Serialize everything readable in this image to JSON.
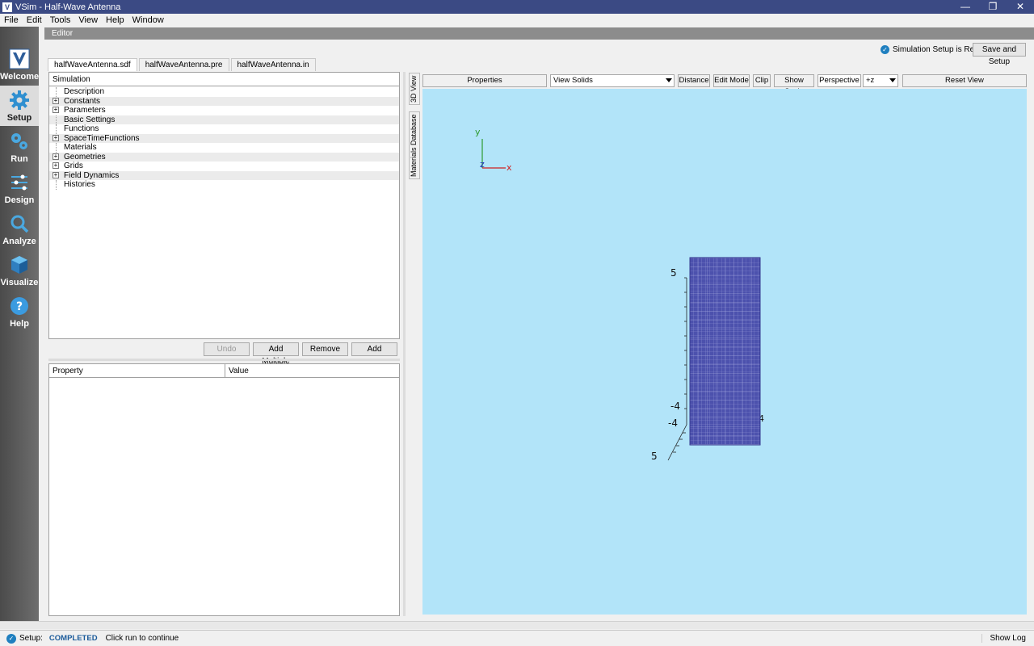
{
  "window": {
    "title": "VSim - Half-Wave Antenna",
    "app_icon": "V",
    "controls": [
      "—",
      "❐",
      "✕"
    ]
  },
  "menu": [
    "File",
    "Edit",
    "Tools",
    "View",
    "Help",
    "Window"
  ],
  "nav": [
    {
      "label": "Welcome",
      "icon": "vsim-logo-icon"
    },
    {
      "label": "Setup",
      "icon": "gear-icon"
    },
    {
      "label": "Run",
      "icon": "gears-icon"
    },
    {
      "label": "Design",
      "icon": "sliders-icon"
    },
    {
      "label": "Analyze",
      "icon": "magnifier-icon"
    },
    {
      "label": "Visualize",
      "icon": "cube-icon"
    },
    {
      "label": "Help",
      "icon": "question-icon"
    }
  ],
  "editor": {
    "header": "Editor",
    "setup_status": "Simulation Setup is Ready",
    "save_setup_label": "Save and Setup",
    "tabs": [
      "halfWaveAntenna.sdf",
      "halfWaveAntenna.pre",
      "halfWaveAntenna.in"
    ],
    "tree_header": "Simulation",
    "tree": [
      {
        "label": "Description",
        "expandable": false
      },
      {
        "label": "Constants",
        "expandable": true
      },
      {
        "label": "Parameters",
        "expandable": true
      },
      {
        "label": "Basic Settings",
        "expandable": false
      },
      {
        "label": "Functions",
        "expandable": false
      },
      {
        "label": "SpaceTimeFunctions",
        "expandable": true
      },
      {
        "label": "Materials",
        "expandable": false
      },
      {
        "label": "Geometries",
        "expandable": true
      },
      {
        "label": "Grids",
        "expandable": true
      },
      {
        "label": "Field Dynamics",
        "expandable": true
      },
      {
        "label": "Histories",
        "expandable": false
      }
    ],
    "buttons": {
      "undo": "Undo",
      "add_multiple": "Add Multiple",
      "remove": "Remove",
      "add": "Add"
    },
    "prop_headers": {
      "property": "Property",
      "value": "Value"
    }
  },
  "side_tabs": [
    "3D View",
    "Materials Database"
  ],
  "viz": {
    "properties": "Properties",
    "view_mode": "View Solids",
    "distance": "Distance",
    "edit_mode": "Edit Mode",
    "clip": "Clip",
    "show_scale": "Show Scale",
    "perspective": "Perspective",
    "axis_dir": "+z",
    "reset_view": "Reset View",
    "axes": {
      "y": "y",
      "x": "x",
      "z": "z"
    },
    "scale_labels": {
      "top": "5",
      "mid1": "-4",
      "mid2": "-4",
      "right": "4",
      "bottom": "5"
    },
    "colors": {
      "background": "#b2e4f9",
      "solid": "#4b4fa8"
    }
  },
  "status": {
    "prefix": "Setup:",
    "state": "COMPLETED",
    "message": "Click run to continue",
    "show_log": "Show Log"
  }
}
